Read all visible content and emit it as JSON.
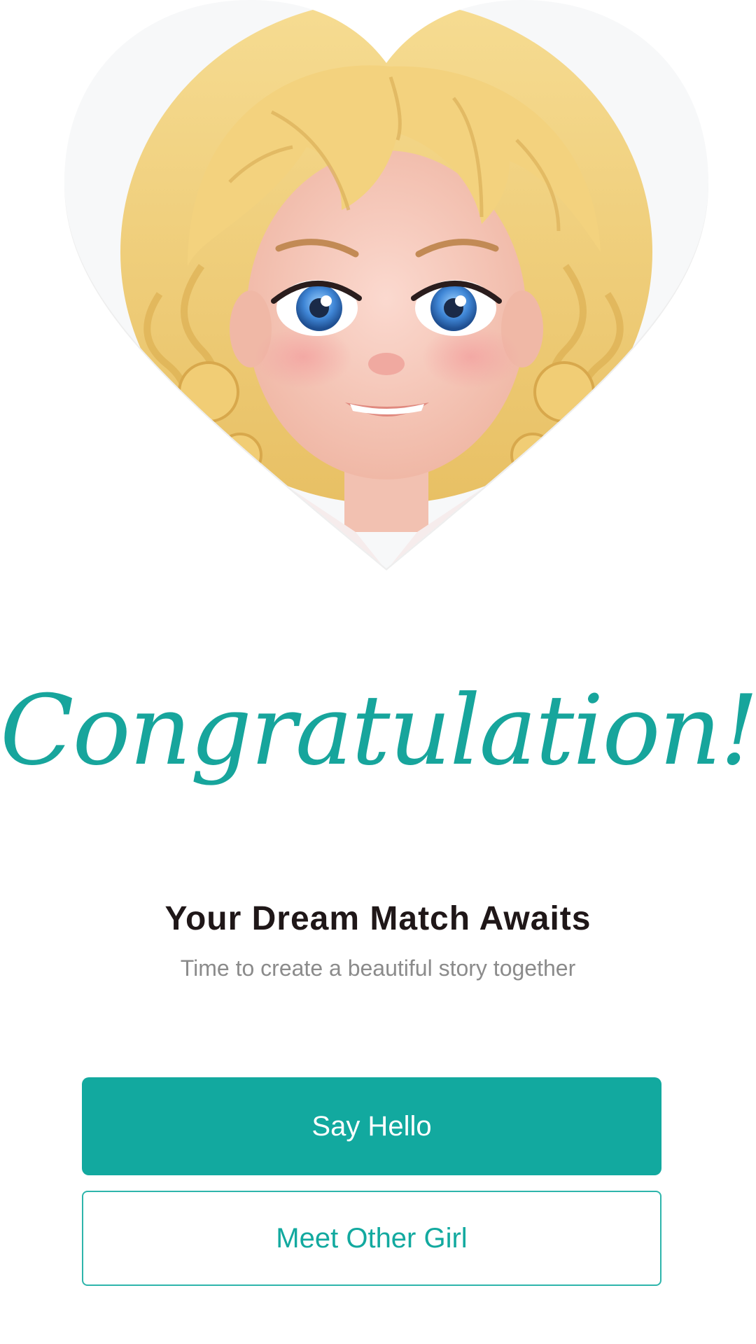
{
  "hero": {
    "image_alt": "Cartoon girl with curly blonde hair and blue eyes, smiling, inside a heart-shaped frame"
  },
  "content": {
    "headline": "Congratulation!",
    "subtitle": "Your Dream Match Awaits",
    "tagline": "Time to create a beautiful story together"
  },
  "actions": {
    "primary_label": "Say Hello",
    "secondary_label": "Meet Other Girl"
  },
  "colors": {
    "accent": "#12a99f",
    "title_text": "#1f1718",
    "muted_text": "#8b8b8b"
  }
}
